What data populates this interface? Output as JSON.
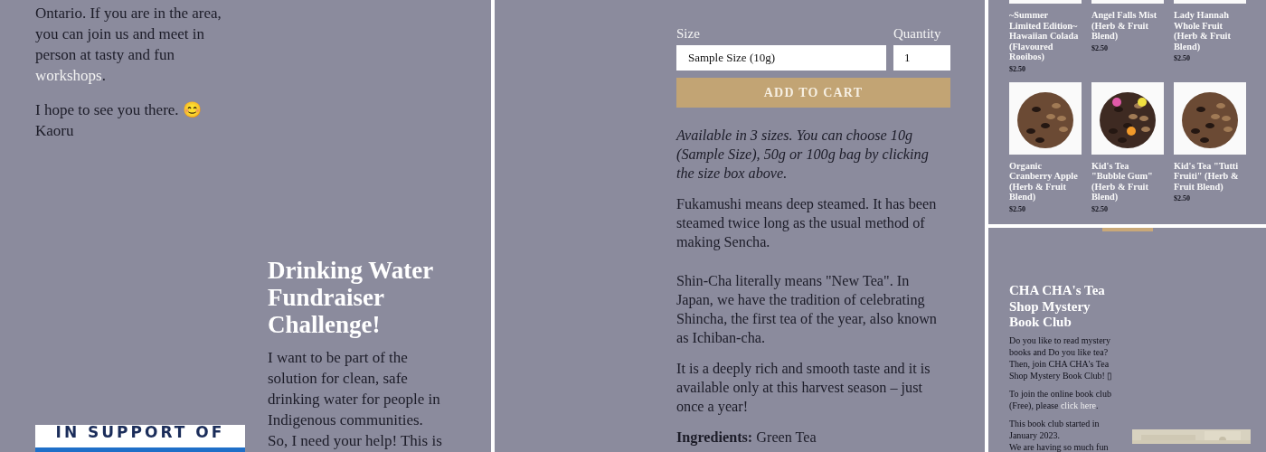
{
  "about": {
    "text_before": "Ontario. If you are in the area, you can join us and meet in person at tasty and fun ",
    "link": "workshops",
    "text_after": ".",
    "closing": [
      "I hope to see you there. 😊",
      "Kaoru"
    ]
  },
  "fundraiser": {
    "title": "Drinking Water Fundraiser Challenge!",
    "body": [
      "I want to be part of the solution for clean, safe drinking water for people in Indigenous communities.",
      "So, I need your help! This is"
    ],
    "banner": "IN SUPPORT OF"
  },
  "product": {
    "size_label": "Size",
    "size_value": "Sample Size (10g)",
    "quantity_label": "Quantity",
    "quantity_value": "1",
    "button": "ADD TO CART",
    "description": "Available in 3 sizes. You can choose 10g (Sample Size), 50g or 100g bag by clicking the size box above.",
    "paragraphs": [
      "Fukamushi means deep steamed. It has been steamed twice long as the usual method of making Sencha.",
      "Shin-Cha literally means \"New Tea\".  In Japan, we have the tradition of celebrating Shincha, the first tea of the year, also known as Ichiban-cha.",
      "It is a deeply rich and smooth taste and it is available only at this harvest season – just once a year!"
    ],
    "ingredients": "**Ingredients:** Green Tea"
  },
  "products": [
    {
      "name": "~Summer Limited Edition~ Hawaiian Colada (Flavoured Rooibos)",
      "price": "$2.50"
    },
    {
      "name": "Angel Falls Mist (Herb & Fruit Blend)",
      "price": "$2.50"
    },
    {
      "name": "Lady Hannah Whole Fruit (Herb & Fruit Blend)",
      "price": "$2.50"
    },
    {
      "name": "Organic Cranberry Apple (Herb & Fruit Blend)",
      "price": "$2.50"
    },
    {
      "name": "Kid's Tea \"Bubble Gum\" (Herb & Fruit Blend)",
      "price": "$2.50"
    },
    {
      "name": "Kid's Tea \"Tutti Fruiti\" (Herb & Fruit Blend)",
      "price": "$2.50"
    }
  ],
  "book_club": {
    "title": "CHA CHA's Tea Shop Mystery Book Club",
    "intro": "Do you like to read mystery books and Do you like tea? Then, join CHA CHA's Tea Shop Mystery Book Club! ▯",
    "join_before": "To join the online book club (Free), please ",
    "join_link": "click here",
    "join_after": ".",
    "history": [
      "This book club started in January 2023.",
      "We are having so much fun"
    ]
  }
}
